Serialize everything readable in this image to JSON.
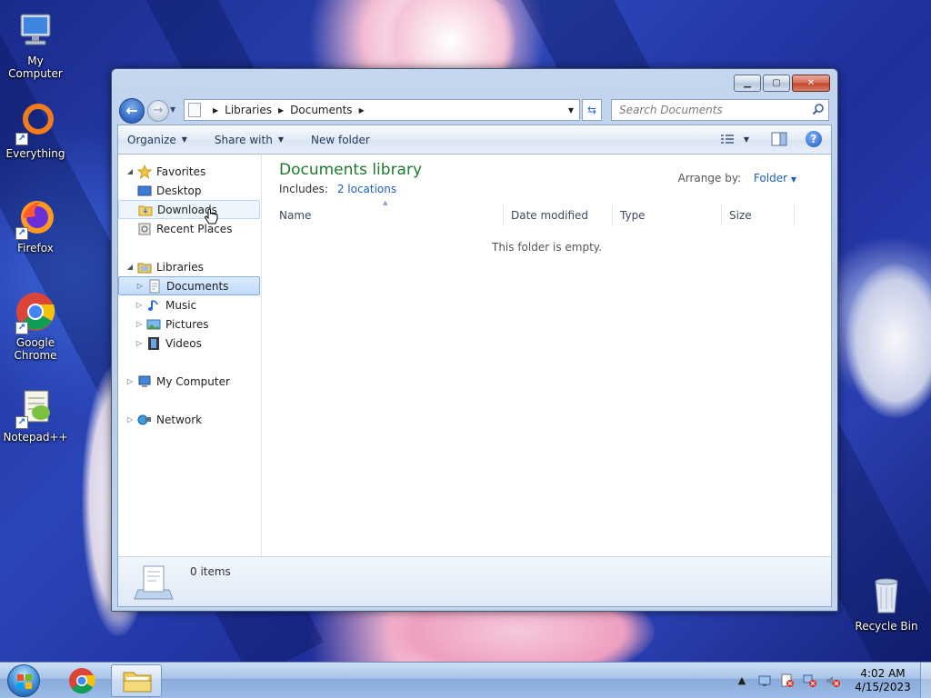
{
  "desktop": {
    "icons": [
      {
        "label": "My Computer"
      },
      {
        "label": "Everything"
      },
      {
        "label": "Firefox"
      },
      {
        "label": "Google Chrome"
      },
      {
        "label": "Notepad++"
      },
      {
        "label": "Recycle Bin"
      }
    ]
  },
  "window": {
    "address": {
      "segments": [
        "Libraries",
        "Documents"
      ]
    },
    "search": {
      "placeholder": "Search Documents"
    },
    "toolbar": {
      "organize": "Organize",
      "share_with": "Share with",
      "new_folder": "New folder",
      "help": "?"
    },
    "nav": {
      "favorites": "Favorites",
      "desktop": "Desktop",
      "downloads": "Downloads",
      "recent": "Recent Places",
      "libraries": "Libraries",
      "documents": "Documents",
      "music": "Music",
      "pictures": "Pictures",
      "videos": "Videos",
      "computer": "My Computer",
      "network": "Network"
    },
    "content": {
      "title": "Documents library",
      "includes_label": "Includes:",
      "includes_link": "2 locations",
      "arrange_label": "Arrange by:",
      "arrange_value": "Folder",
      "columns": [
        "Name",
        "Date modified",
        "Type",
        "Size"
      ],
      "empty_message": "This folder is empty."
    },
    "details": {
      "item_count": "0 items"
    }
  },
  "taskbar": {
    "clock_time": "4:02 AM",
    "clock_date": "4/15/2023"
  },
  "colors": {
    "accent": "#1e5fb8",
    "library_title": "#1e7a2e",
    "selection": "#c1dbfc"
  }
}
